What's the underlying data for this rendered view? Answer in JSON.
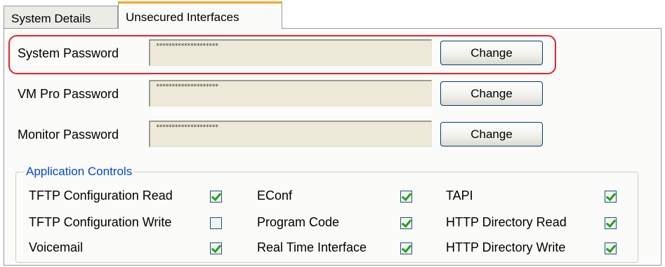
{
  "tabs": [
    {
      "label": "System Details",
      "active": false
    },
    {
      "label": "Unsecured Interfaces",
      "active": true
    }
  ],
  "passwords": [
    {
      "label": "System Password",
      "value": "********************",
      "button": "Change",
      "highlighted": true
    },
    {
      "label": "VM Pro Password",
      "value": "********************",
      "button": "Change",
      "highlighted": false
    },
    {
      "label": "Monitor Password",
      "value": "********************",
      "button": "Change",
      "highlighted": false
    }
  ],
  "application_controls": {
    "title": "Application Controls",
    "columns": [
      [
        {
          "label": "TFTP Configuration Read",
          "checked": true
        },
        {
          "label": "TFTP Configuration Write",
          "checked": false
        },
        {
          "label": "Voicemail",
          "checked": true
        }
      ],
      [
        {
          "label": "EConf",
          "checked": true
        },
        {
          "label": "Program Code",
          "checked": true
        },
        {
          "label": "Real Time Interface",
          "checked": true
        }
      ],
      [
        {
          "label": "TAPI",
          "checked": true
        },
        {
          "label": "HTTP Directory Read",
          "checked": true
        },
        {
          "label": "HTTP Directory Write",
          "checked": true
        }
      ]
    ]
  },
  "colors": {
    "highlight_outline": "#e8202a",
    "group_title": "#0046d5",
    "check_mark": "#21a121",
    "active_tab_accent": "#f5a623"
  }
}
